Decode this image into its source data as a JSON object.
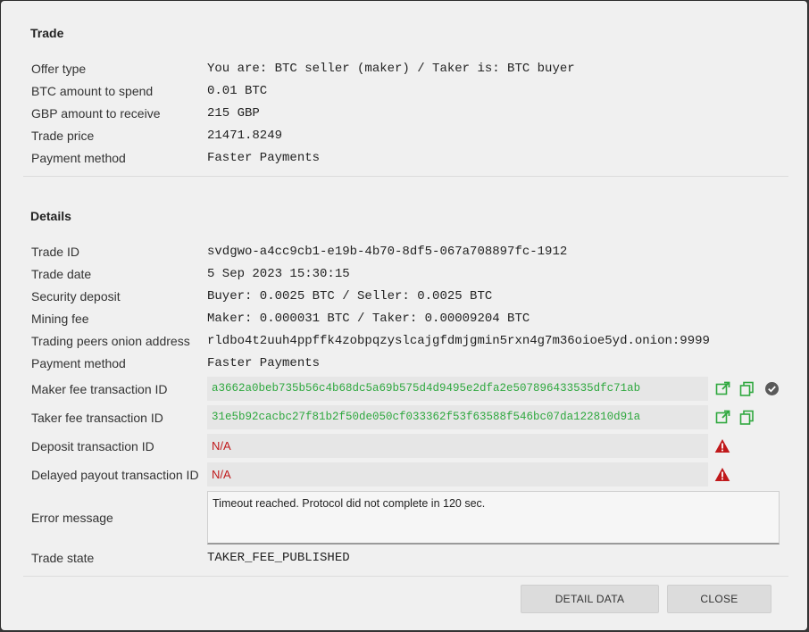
{
  "trade": {
    "title": "Trade",
    "rows": [
      {
        "label": "Offer type",
        "value": "You are: BTC seller (maker) / Taker is: BTC buyer"
      },
      {
        "label": "BTC amount to spend",
        "value": "0.01 BTC"
      },
      {
        "label": "GBP amount to receive",
        "value": "215 GBP"
      },
      {
        "label": "Trade price",
        "value": "21471.8249"
      },
      {
        "label": "Payment method",
        "value": "Faster Payments"
      }
    ]
  },
  "details": {
    "title": "Details",
    "rows": [
      {
        "label": "Trade ID",
        "value": "svdgwo-a4cc9cb1-e19b-4b70-8df5-067a708897fc-1912"
      },
      {
        "label": "Trade date",
        "value": "5 Sep 2023 15:30:15"
      },
      {
        "label": "Security deposit",
        "value": "Buyer: 0.0025 BTC / Seller: 0.0025 BTC"
      },
      {
        "label": "Mining fee",
        "value": "Maker: 0.000031 BTC / Taker: 0.00009204 BTC"
      },
      {
        "label": "Trading peers onion address",
        "value": "rldbo4t2uuh4ppffk4zobpqzyslcajgfdmjgmin5rxn4g7m36oioe5yd.onion:9999"
      },
      {
        "label": "Payment method",
        "value": "Faster Payments"
      }
    ],
    "maker_fee": {
      "label": "Maker fee transaction ID",
      "value": "a3662a0beb735b56c4b68dc5a69b575d4d9495e2dfa2e507896433535dfc71ab"
    },
    "taker_fee": {
      "label": "Taker fee transaction ID",
      "value": "31e5b92cacbc27f81b2f50de050cf033362f53f63588f546bc07da122810d91a"
    },
    "deposit": {
      "label": "Deposit transaction ID",
      "value": "N/A"
    },
    "delayed_payout": {
      "label": "Delayed payout transaction ID",
      "value": "N/A"
    },
    "error": {
      "label": "Error message",
      "value": "Timeout reached. Protocol did not complete in 120 sec."
    },
    "state": {
      "label": "Trade state",
      "value": "TAKER_FEE_PUBLISHED"
    }
  },
  "buttons": {
    "detail_data": "DETAIL DATA",
    "close": "CLOSE"
  },
  "colors": {
    "link_green": "#2fa83f",
    "error_red": "#c0191b",
    "confirmed_grey": "#5a5a5a"
  },
  "icons": {
    "open": "external-link-icon",
    "copy": "copy-icon",
    "confirmed": "check-circle-icon",
    "warning": "warning-icon"
  }
}
